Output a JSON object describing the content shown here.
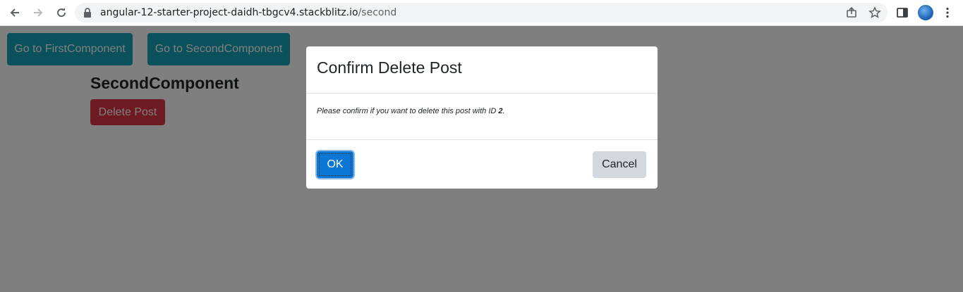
{
  "browser": {
    "url_host": "angular-12-starter-project-daidh-tbgcv4.stackblitz.io",
    "url_path": "/second",
    "icons": [
      "back-icon",
      "forward-icon",
      "reload-icon",
      "lock-icon",
      "share-icon",
      "star-icon",
      "side-panel-icon",
      "profile-avatar",
      "menu-dots-icon"
    ]
  },
  "page": {
    "nav_first_label": "Go to FirstComponent",
    "nav_second_label": "Go to SecondComponent",
    "component_title": "SecondComponent",
    "delete_label": "Delete Post"
  },
  "modal": {
    "title": "Confirm Delete Post",
    "body_prefix": "Please confirm if you want to delete this post with ID ",
    "post_id": "2",
    "body_suffix": ".",
    "ok_label": "OK",
    "cancel_label": "Cancel"
  },
  "colors": {
    "teal": "#17a2b8",
    "danger": "#dc3545",
    "primary": "#0b77d4",
    "secondary": "#d3d8de"
  }
}
